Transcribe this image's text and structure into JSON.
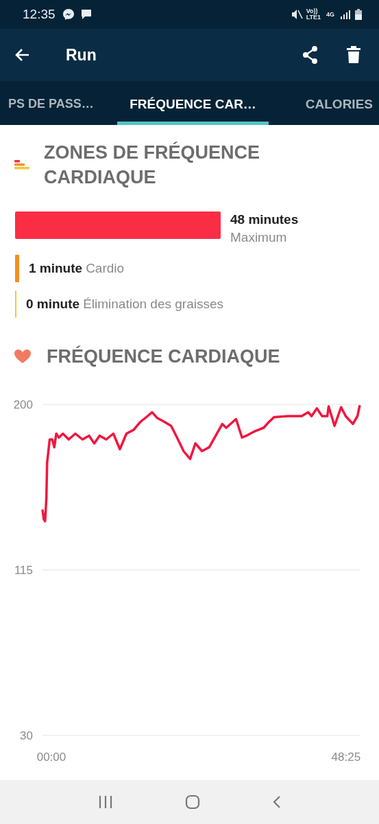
{
  "status_bar": {
    "time": "12:35",
    "network": "4G",
    "carrier_badge": "Vo))",
    "lte": "LTE1"
  },
  "app_bar": {
    "title": "Run"
  },
  "tabs": [
    {
      "label": "PS DE PASS…",
      "selected": false
    },
    {
      "label": "FRÉQUENCE CAR…",
      "selected": true
    },
    {
      "label": "CALORIES",
      "selected": false
    }
  ],
  "zones_section": {
    "title": "ZONES DE FRÉQUENCE CARDIAQUE",
    "zones": [
      {
        "kind": "bar",
        "duration": "48 minutes",
        "name": "Maximum",
        "color": "#fb2d45"
      },
      {
        "kind": "thick-line",
        "duration": "1 minute",
        "name": "Cardio",
        "color": "#f5901e"
      },
      {
        "kind": "thin-line",
        "duration": "0 minute",
        "name": "Élimination des graisses",
        "color": "#f3c93c"
      }
    ]
  },
  "heart_rate_section": {
    "title": "FRÉQUENCE CARDIAQUE",
    "chart_data": {
      "type": "line",
      "ylim": [
        30,
        200
      ],
      "yticks": [
        30,
        115,
        200
      ],
      "xlim": [
        -1.46,
        50.8
      ],
      "xticks": [
        {
          "value": 0,
          "label": "00:00"
        },
        {
          "value": 48.42,
          "label": "48:25"
        }
      ],
      "x": [
        -1.46,
        -1.25,
        -1.03,
        -0.82,
        -0.71,
        -0.49,
        -0.28,
        0.15,
        0.48,
        0.8,
        1.23,
        1.88,
        2.85,
        3.93,
        5.12,
        6.19,
        7.06,
        7.92,
        9.0,
        10.19,
        11.26,
        12.34,
        13.53,
        14.61,
        15.79,
        16.55,
        17.41,
        18.6,
        19.68,
        20.65,
        21.73,
        22.8,
        23.67,
        24.75,
        25.93,
        27.01,
        28.09,
        28.74,
        30.35,
        31.33,
        32.08,
        33.27,
        34.88,
        35.75,
        36.61,
        38.87,
        41.14,
        42.22,
        42.76,
        43.62,
        44.49,
        45.35,
        45.56,
        46.53,
        47.61,
        48.37,
        49.55,
        50.31,
        50.68
      ],
      "series": [
        {
          "color": "#f0173f",
          "values": [
            146,
            141,
            140,
            152,
            170,
            176,
            182,
            182,
            178,
            185,
            183,
            185,
            182,
            185,
            182,
            184,
            180,
            184,
            182,
            185,
            177,
            185,
            187,
            191,
            194,
            196,
            193,
            191,
            189,
            183,
            176,
            172,
            180,
            176,
            178,
            184,
            190,
            188,
            192.5,
            183,
            184,
            186,
            188,
            191,
            193.5,
            194,
            194,
            196,
            194,
            198,
            194,
            194,
            199,
            189,
            198.6,
            194,
            190,
            194,
            199.6
          ]
        }
      ]
    }
  }
}
